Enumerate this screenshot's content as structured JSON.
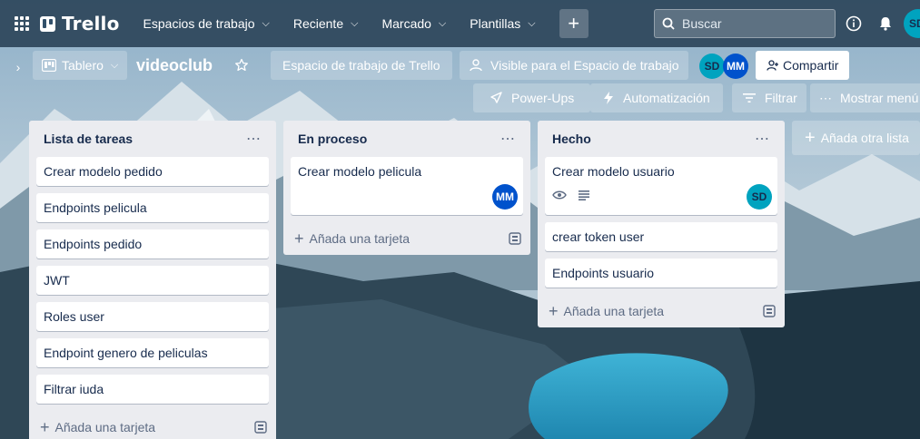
{
  "header": {
    "logo": "Trello",
    "nav": [
      {
        "label": "Espacios de trabajo"
      },
      {
        "label": "Reciente"
      },
      {
        "label": "Marcado"
      },
      {
        "label": "Plantillas"
      }
    ],
    "search_placeholder": "Buscar",
    "user_initials": "SD"
  },
  "board": {
    "view_label": "Tablero",
    "title": "videoclub",
    "workspace_label": "Espacio de trabajo de Trello",
    "visibility_label": "Visible para el Espacio de trabajo",
    "members": [
      {
        "initials": "SD",
        "color": "#00a3bf"
      },
      {
        "initials": "MM",
        "color": "#0052cc"
      }
    ],
    "share_label": "Compartir",
    "powerups_label": "Power-Ups",
    "automation_label": "Automatización",
    "filter_label": "Filtrar",
    "menu_label": "Mostrar menú"
  },
  "lists": [
    {
      "title": "Lista de tareas",
      "cards": [
        {
          "title": "Crear modelo pedido"
        },
        {
          "title": "Endpoints pelicula"
        },
        {
          "title": "Endpoints pedido"
        },
        {
          "title": "JWT"
        },
        {
          "title": "Roles user"
        },
        {
          "title": "Endpoint genero de peliculas"
        },
        {
          "title": "Filtrar iuda"
        }
      ],
      "add_card_label": "Añada una tarjeta"
    },
    {
      "title": "En proceso",
      "cards": [
        {
          "title": "Crear modelo pelicula",
          "member": "MM"
        }
      ],
      "add_card_label": "Añada una tarjeta"
    },
    {
      "title": "Hecho",
      "cards": [
        {
          "title": "Crear modelo usuario",
          "member": "SD"
        },
        {
          "title": "crear token user"
        },
        {
          "title": "Endpoints usuario"
        }
      ],
      "add_card_label": "Añada una tarjeta"
    }
  ],
  "add_list_label": "Añada otra lista",
  "colors": {
    "accent_sd": "#00a3bf",
    "accent_mm": "#0052cc",
    "list_bg": "#ebecf0"
  }
}
